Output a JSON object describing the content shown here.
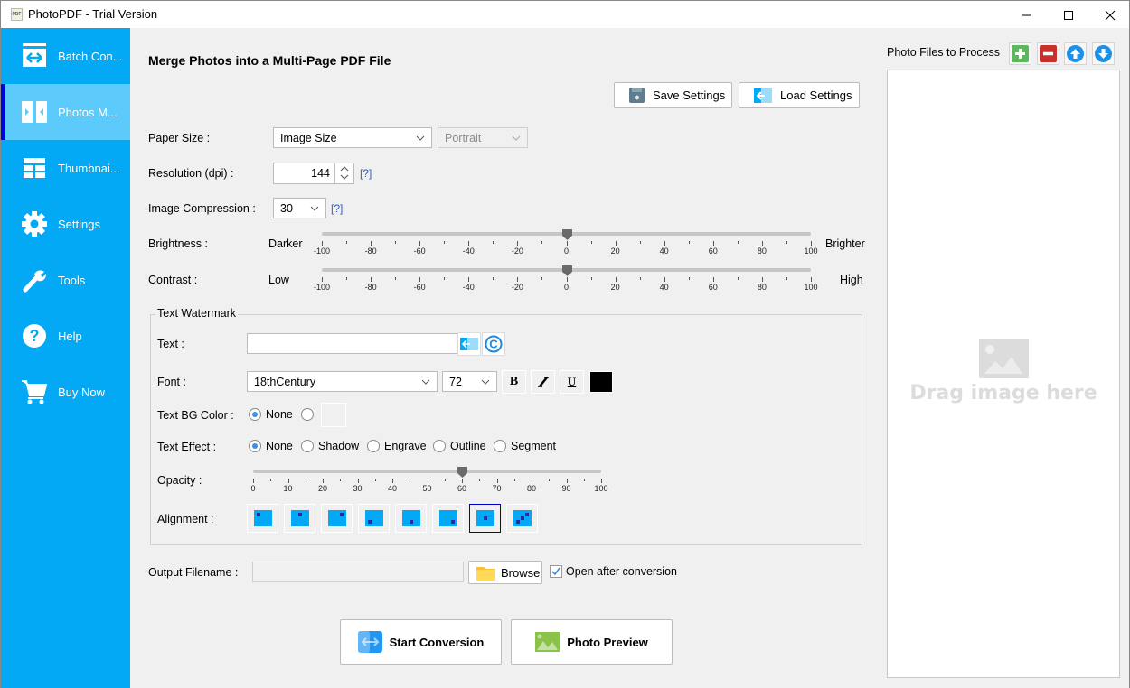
{
  "window": {
    "title": "PhotoPDF - Trial Version",
    "app_icon_text": "PDF"
  },
  "sidebar": {
    "items": [
      {
        "label": "Batch Con...",
        "icon": "batch-convert-icon",
        "active": false
      },
      {
        "label": "Photos M...",
        "icon": "photos-merge-icon",
        "active": true
      },
      {
        "label": "Thumbnai...",
        "icon": "thumbnail-grid-icon",
        "active": false
      },
      {
        "label": "Settings",
        "icon": "gear-icon",
        "active": false
      },
      {
        "label": "Tools",
        "icon": "wrench-icon",
        "active": false
      },
      {
        "label": "Help",
        "icon": "help-icon",
        "active": false
      },
      {
        "label": "Buy Now",
        "icon": "cart-icon",
        "active": false
      }
    ]
  },
  "main": {
    "title": "Merge Photos into a Multi-Page PDF File",
    "save_settings": "Save Settings",
    "load_settings": "Load Settings",
    "paper_size": {
      "label": "Paper Size :",
      "value": "Image Size",
      "orientation": "Portrait"
    },
    "resolution": {
      "label": "Resolution (dpi) :",
      "value": "144",
      "help": "[?]"
    },
    "compression": {
      "label": "Image Compression :",
      "value": "30",
      "help": "[?]"
    },
    "brightness": {
      "label": "Brightness :",
      "min_label": "Darker",
      "max_label": "Brighter",
      "value": 0,
      "min": -100,
      "max": 100,
      "ticks": [
        "-100",
        "-80",
        "-60",
        "-40",
        "-20",
        "0",
        "20",
        "40",
        "60",
        "80",
        "100"
      ]
    },
    "contrast": {
      "label": "Contrast :",
      "min_label": "Low",
      "max_label": "High",
      "value": 0,
      "min": -100,
      "max": 100,
      "ticks": [
        "-100",
        "-80",
        "-60",
        "-40",
        "-20",
        "0",
        "20",
        "40",
        "60",
        "80",
        "100"
      ]
    },
    "watermark": {
      "legend": "Text Watermark",
      "text_label": "Text :",
      "text_value": "",
      "font_label": "Font :",
      "font_value": "18thCentury",
      "font_size": "72",
      "bold": "B",
      "italic": "I",
      "underline": "U",
      "font_color": "#000000",
      "bg_label": "Text BG Color :",
      "bg_none": "None",
      "effect_label": "Text Effect  :",
      "effects": [
        "None",
        "Shadow",
        "Engrave",
        "Outline",
        "Segment"
      ],
      "effect_selected": "None",
      "opacity_label": "Opacity :",
      "opacity": {
        "value": 60,
        "min": 0,
        "max": 100,
        "ticks": [
          "0",
          "10",
          "20",
          "30",
          "40",
          "50",
          "60",
          "70",
          "80",
          "90",
          "100"
        ]
      },
      "alignment_label": "Alignment :",
      "alignments": [
        "top-left",
        "top-center",
        "top-right",
        "bottom-left",
        "bottom-center",
        "bottom-right",
        "center",
        "diagonal"
      ],
      "alignment_selected": "center"
    },
    "output": {
      "label": "Output Filename :",
      "value": "",
      "browse": "Browse",
      "open_after": "Open after conversion",
      "open_after_checked": true
    },
    "start_conversion": "Start Conversion",
    "photo_preview": "Photo Preview"
  },
  "right_panel": {
    "title": "Photo Files to Process",
    "drop_text": "Drag image here",
    "buttons": [
      "add-icon",
      "remove-icon",
      "move-up-icon",
      "move-down-icon"
    ]
  },
  "colors": {
    "sidebar": "#03a9f4",
    "sidebar_active": "#5ccbfb",
    "active_marker": "#0000e0",
    "link": "#2b5fbf"
  }
}
